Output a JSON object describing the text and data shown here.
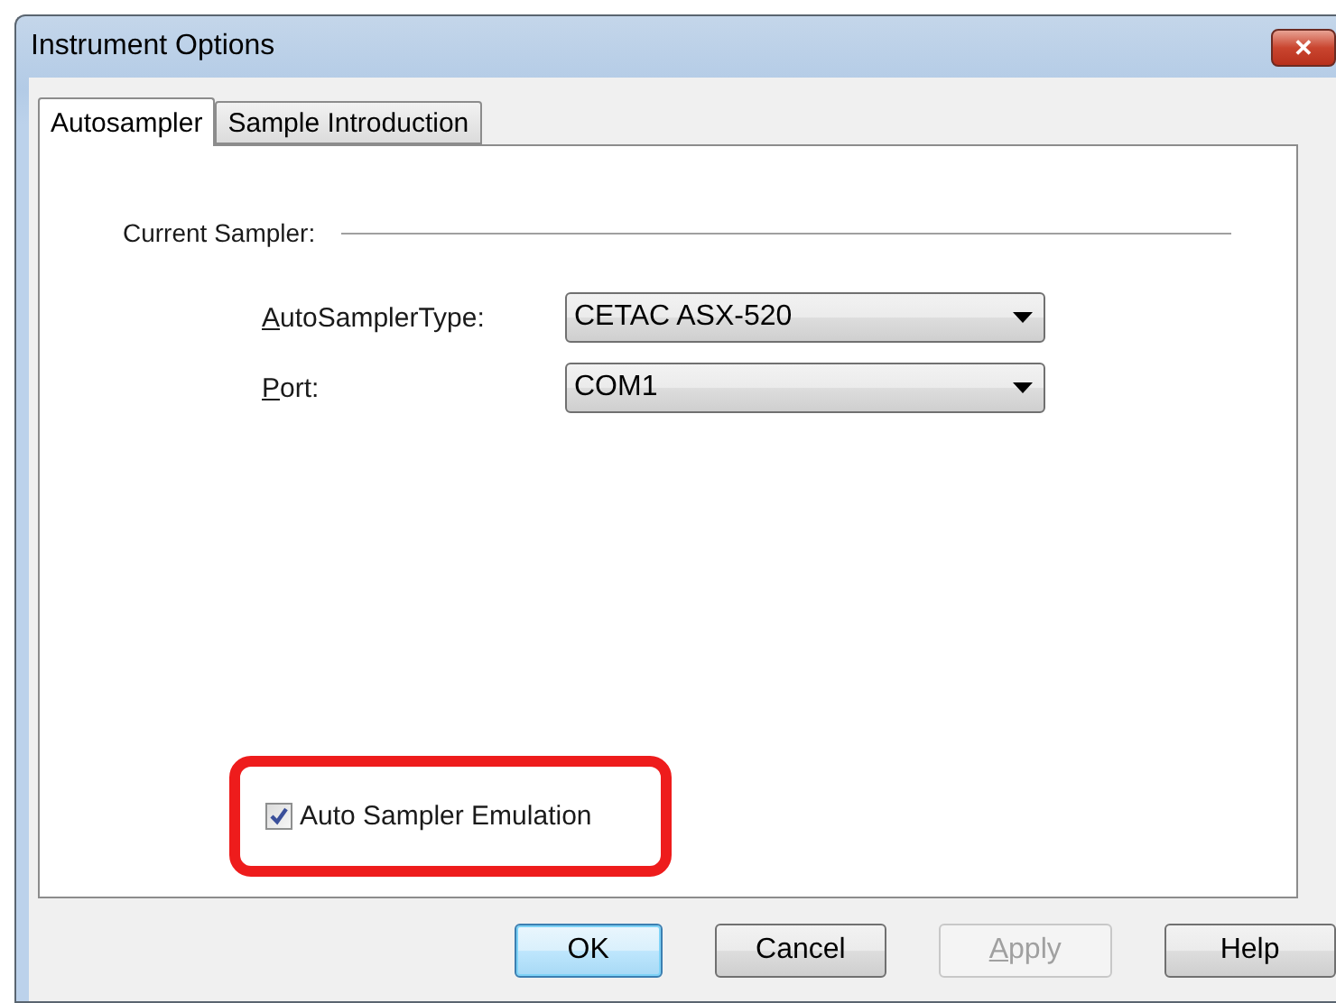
{
  "window": {
    "title": "Instrument Options",
    "close_button": "✕"
  },
  "tabs": [
    {
      "label": "Autosampler",
      "selected": true
    },
    {
      "label": "Sample Introduction",
      "selected": false
    }
  ],
  "group": {
    "label": "Current Sampler:"
  },
  "fields": [
    {
      "label": "AutoSamplerType:",
      "underline_first": true,
      "value": "CETAC ASX-520"
    },
    {
      "label": "Port:",
      "underline_first": true,
      "value": "COM1"
    }
  ],
  "checkbox": {
    "label": "Auto Sampler Emulation",
    "checked": true,
    "highlighted": true
  },
  "buttons": [
    {
      "label": "OK",
      "default": true,
      "disabled": false,
      "underline_first": false
    },
    {
      "label": "Cancel",
      "default": false,
      "disabled": false,
      "underline_first": false
    },
    {
      "label": "Apply",
      "default": false,
      "disabled": true,
      "underline_first": true
    },
    {
      "label": "Help",
      "default": false,
      "disabled": false,
      "underline_first": false
    }
  ]
}
